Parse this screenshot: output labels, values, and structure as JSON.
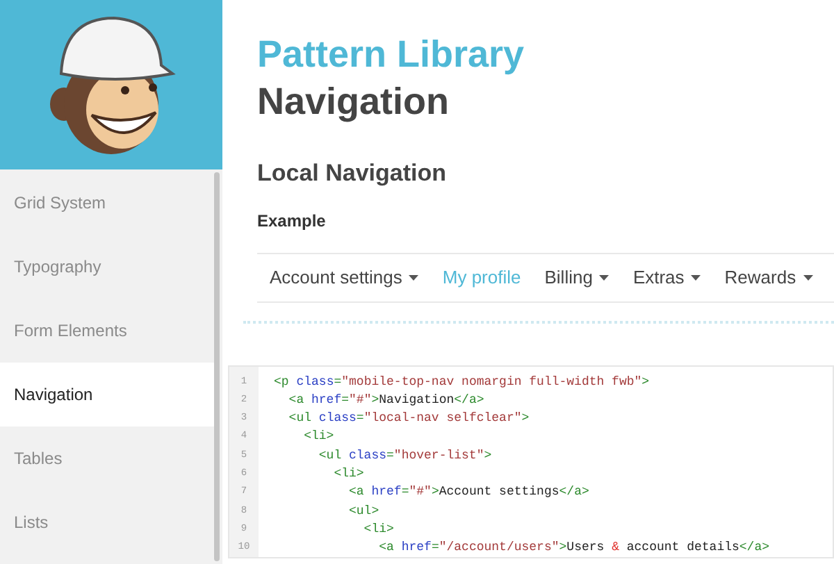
{
  "sidebar": {
    "items": [
      {
        "label": "Grid System",
        "selected": false
      },
      {
        "label": "Typography",
        "selected": false
      },
      {
        "label": "Form Elements",
        "selected": false
      },
      {
        "label": "Navigation",
        "selected": true
      },
      {
        "label": "Tables",
        "selected": false
      },
      {
        "label": "Lists",
        "selected": false
      }
    ]
  },
  "header": {
    "title": "Pattern Library",
    "subtitle": "Navigation"
  },
  "section": {
    "title": "Local Navigation",
    "example_label": "Example"
  },
  "local_nav": {
    "items": [
      {
        "label": "Account settings",
        "dropdown": true,
        "selected": false
      },
      {
        "label": "My profile",
        "dropdown": false,
        "selected": true
      },
      {
        "label": "Billing",
        "dropdown": true,
        "selected": false
      },
      {
        "label": "Extras",
        "dropdown": true,
        "selected": false
      },
      {
        "label": "Rewards",
        "dropdown": true,
        "selected": false
      }
    ]
  },
  "code": {
    "lines": [
      {
        "number": "1",
        "tokens": [
          {
            "kind": "tag",
            "text": "<p"
          },
          {
            "kind": "attr",
            "text": " class"
          },
          {
            "kind": "tag",
            "text": "="
          },
          {
            "kind": "value",
            "text": "\"mobile-top-nav nomargin full-width fwb\""
          },
          {
            "kind": "tag",
            "text": ">"
          }
        ]
      },
      {
        "number": "2",
        "tokens": [
          {
            "kind": "tag",
            "text": "  <a"
          },
          {
            "kind": "attr",
            "text": " href"
          },
          {
            "kind": "tag",
            "text": "="
          },
          {
            "kind": "value",
            "text": "\"#\""
          },
          {
            "kind": "tag",
            "text": ">"
          },
          {
            "kind": "text",
            "text": "Navigation"
          },
          {
            "kind": "tag",
            "text": "</a>"
          }
        ]
      },
      {
        "number": "3",
        "tokens": [
          {
            "kind": "tag",
            "text": "  <ul"
          },
          {
            "kind": "attr",
            "text": " class"
          },
          {
            "kind": "tag",
            "text": "="
          },
          {
            "kind": "value",
            "text": "\"local-nav selfclear\""
          },
          {
            "kind": "tag",
            "text": ">"
          }
        ]
      },
      {
        "number": "4",
        "tokens": [
          {
            "kind": "tag",
            "text": "    <li>"
          }
        ]
      },
      {
        "number": "5",
        "tokens": [
          {
            "kind": "tag",
            "text": "      <ul"
          },
          {
            "kind": "attr",
            "text": " class"
          },
          {
            "kind": "tag",
            "text": "="
          },
          {
            "kind": "value",
            "text": "\"hover-list\""
          },
          {
            "kind": "tag",
            "text": ">"
          }
        ]
      },
      {
        "number": "6",
        "tokens": [
          {
            "kind": "tag",
            "text": "        <li>"
          }
        ]
      },
      {
        "number": "7",
        "tokens": [
          {
            "kind": "tag",
            "text": "          <a"
          },
          {
            "kind": "attr",
            "text": " href"
          },
          {
            "kind": "tag",
            "text": "="
          },
          {
            "kind": "value",
            "text": "\"#\""
          },
          {
            "kind": "tag",
            "text": ">"
          },
          {
            "kind": "text",
            "text": "Account settings"
          },
          {
            "kind": "tag",
            "text": "</a>"
          }
        ]
      },
      {
        "number": "8",
        "tokens": [
          {
            "kind": "tag",
            "text": "          <ul>"
          }
        ]
      },
      {
        "number": "9",
        "tokens": [
          {
            "kind": "tag",
            "text": "            <li>"
          }
        ]
      },
      {
        "number": "10",
        "tokens": [
          {
            "kind": "tag",
            "text": "              <a"
          },
          {
            "kind": "attr",
            "text": " href"
          },
          {
            "kind": "tag",
            "text": "="
          },
          {
            "kind": "value",
            "text": "\"/account/users\""
          },
          {
            "kind": "tag",
            "text": ">"
          },
          {
            "kind": "text",
            "text": "Users "
          },
          {
            "kind": "entity",
            "text": "&"
          },
          {
            "kind": "text",
            "text": " account details"
          },
          {
            "kind": "tag",
            "text": "</a>"
          }
        ]
      }
    ]
  }
}
